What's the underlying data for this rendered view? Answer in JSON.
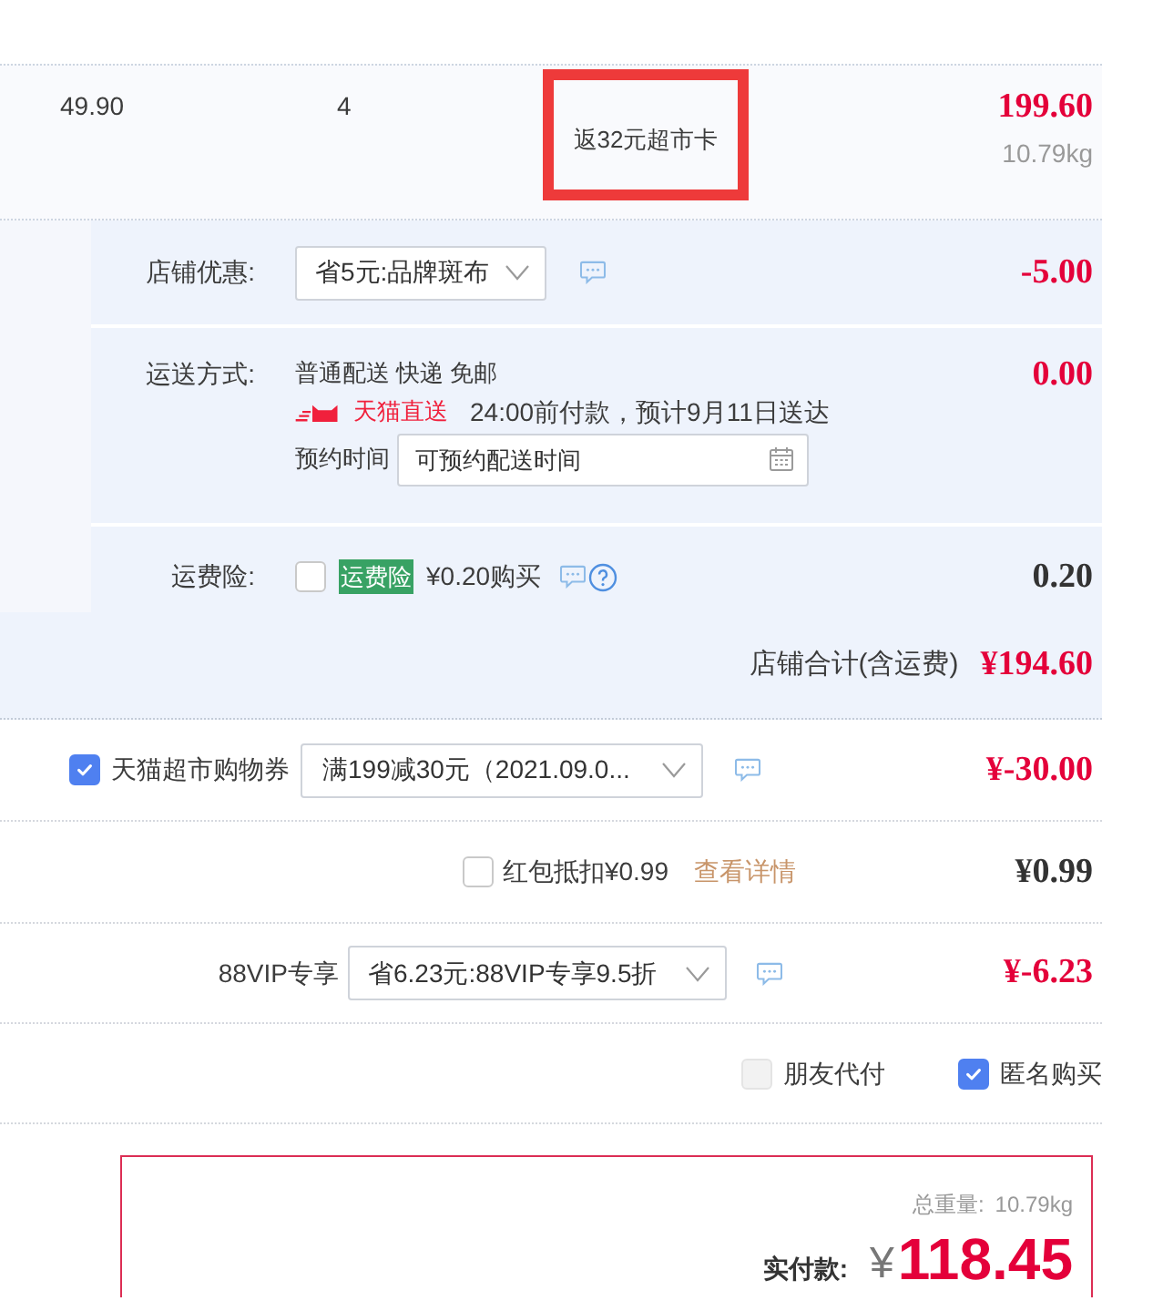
{
  "order_item": {
    "unit_price": "49.90",
    "quantity": "4",
    "promo_note": {
      "text": "返32元超市卡",
      "highlighted": true
    },
    "subtotal": "199.60",
    "weight": "10.79kg"
  },
  "shop": {
    "discount": {
      "label": "店铺优惠:",
      "value": "省5元:品牌斑布",
      "amount": "-5.00"
    },
    "shipping": {
      "label": "运送方式:",
      "method": "普通配送 快递 免邮",
      "service_badge": "天猫直送",
      "delivery_note": "24:00前付款，预计9月11日送达",
      "schedule_label": "预约时间",
      "schedule_field": {
        "placeholder": "可预约配送时间"
      },
      "amount": "0.00"
    },
    "insurance": {
      "label": "运费险:",
      "checked": false,
      "badge": "运费险",
      "price": "¥0.20购买",
      "amount": "0.20"
    },
    "total": {
      "label": "店铺合计(含运费)",
      "amount": "¥194.60"
    }
  },
  "coupon": {
    "checked": true,
    "label": "天猫超市购物券",
    "value": "满199减30元（2021.09.0...",
    "amount": "¥-30.00"
  },
  "red_packet": {
    "checked": false,
    "label": "红包抵扣¥0.99",
    "link": "查看详情",
    "amount": "¥0.99"
  },
  "vip_discount": {
    "label": "88VIP专享",
    "value": "省6.23元:88VIP专享9.5折",
    "amount": "¥-6.23"
  },
  "options": [
    {
      "label": "朋友代付",
      "checked": false,
      "disabled": true
    },
    {
      "label": "匿名购买",
      "checked": true,
      "disabled": false
    }
  ],
  "order_summary": {
    "weight_label": "总重量:",
    "weight": "10.79kg",
    "pay_label": "实付款:",
    "currency": "¥",
    "pay_amount": "118.45"
  }
}
